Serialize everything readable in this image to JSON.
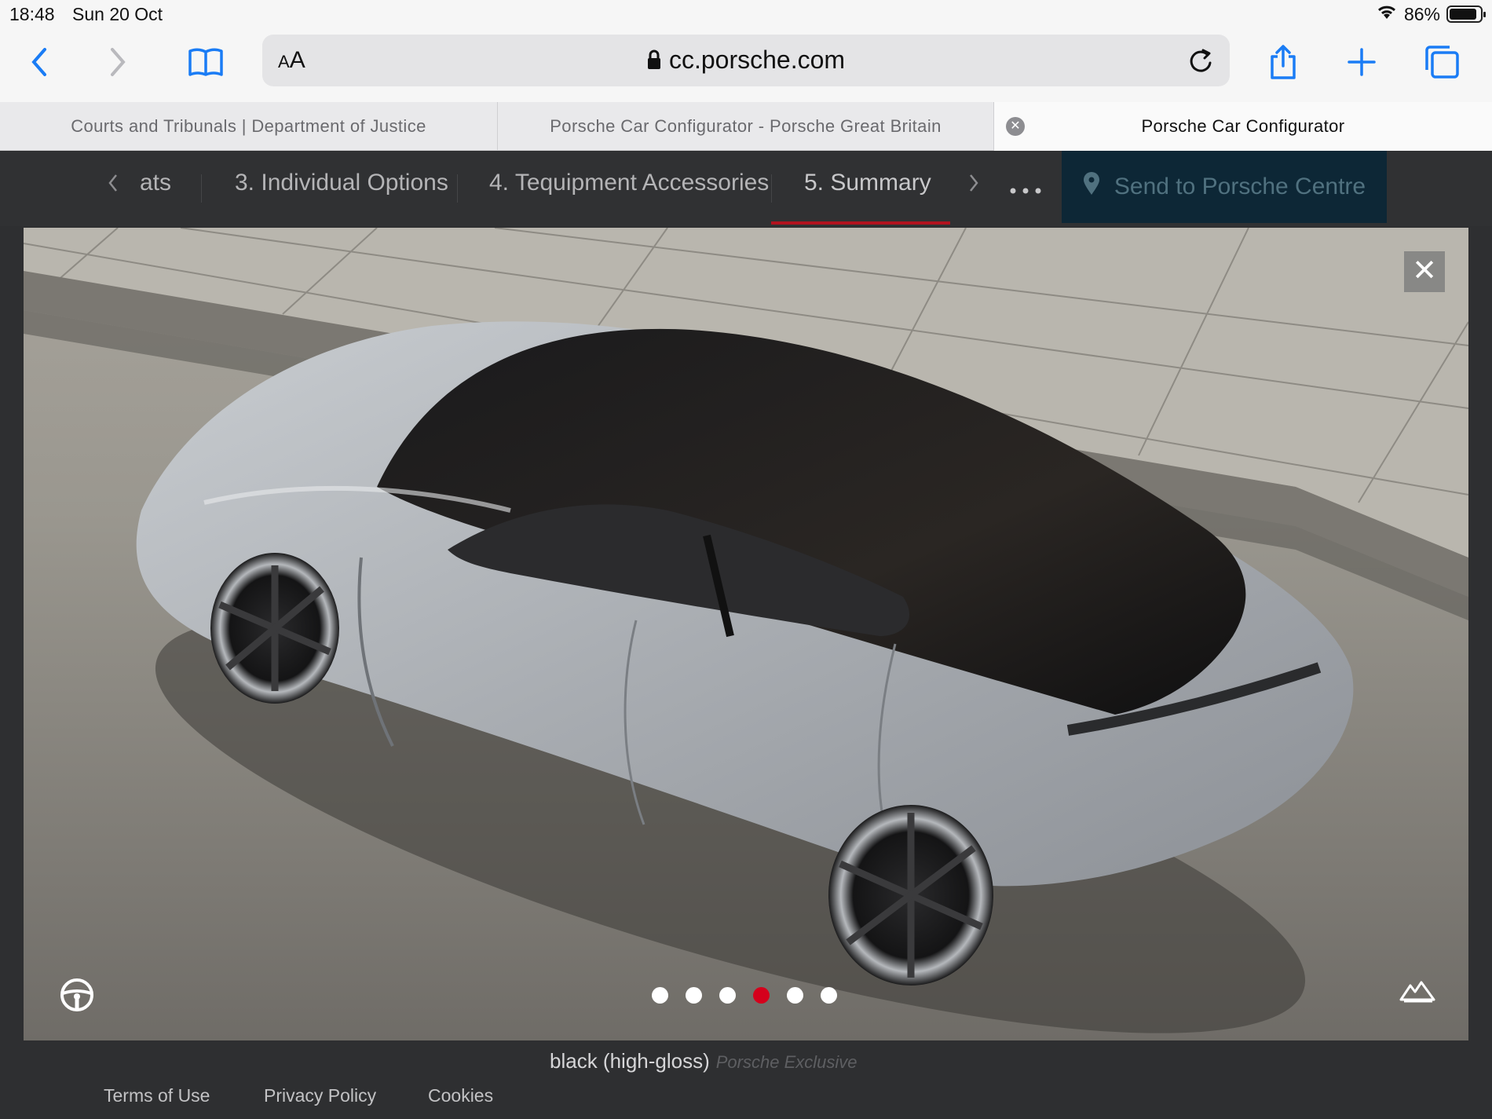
{
  "status_bar": {
    "time": "18:48",
    "date": "Sun 20 Oct",
    "battery": "86%"
  },
  "browser": {
    "address": {
      "aa_small": "A",
      "aa_large": "A",
      "url": "cc.porsche.com"
    },
    "tabs": [
      {
        "title": "Courts and Tribunals | Department of Justice"
      },
      {
        "title": "Porsche Car Configurator - Porsche Great Britain"
      },
      {
        "title": "Porsche Car Configurator"
      }
    ]
  },
  "configurator": {
    "steps": [
      {
        "label": "ats"
      },
      {
        "label": "3. Individual Options"
      },
      {
        "label": "4. Tequipment Accessories"
      },
      {
        "label": "5. Summary"
      }
    ],
    "send_button": "Send to Porsche Centre"
  },
  "gallery": {
    "slide_count": 6,
    "active_slide": 4
  },
  "summary": {
    "option_text": "black (high-gloss)",
    "option_tag": "Porsche Exclusive"
  },
  "footer": {
    "links": [
      "Terms of Use",
      "Privacy Policy",
      "Cookies"
    ]
  },
  "colors": {
    "accent": "#d5001c",
    "send_button_bg": "#0d2736",
    "ios_blue": "#1a7cf5"
  }
}
